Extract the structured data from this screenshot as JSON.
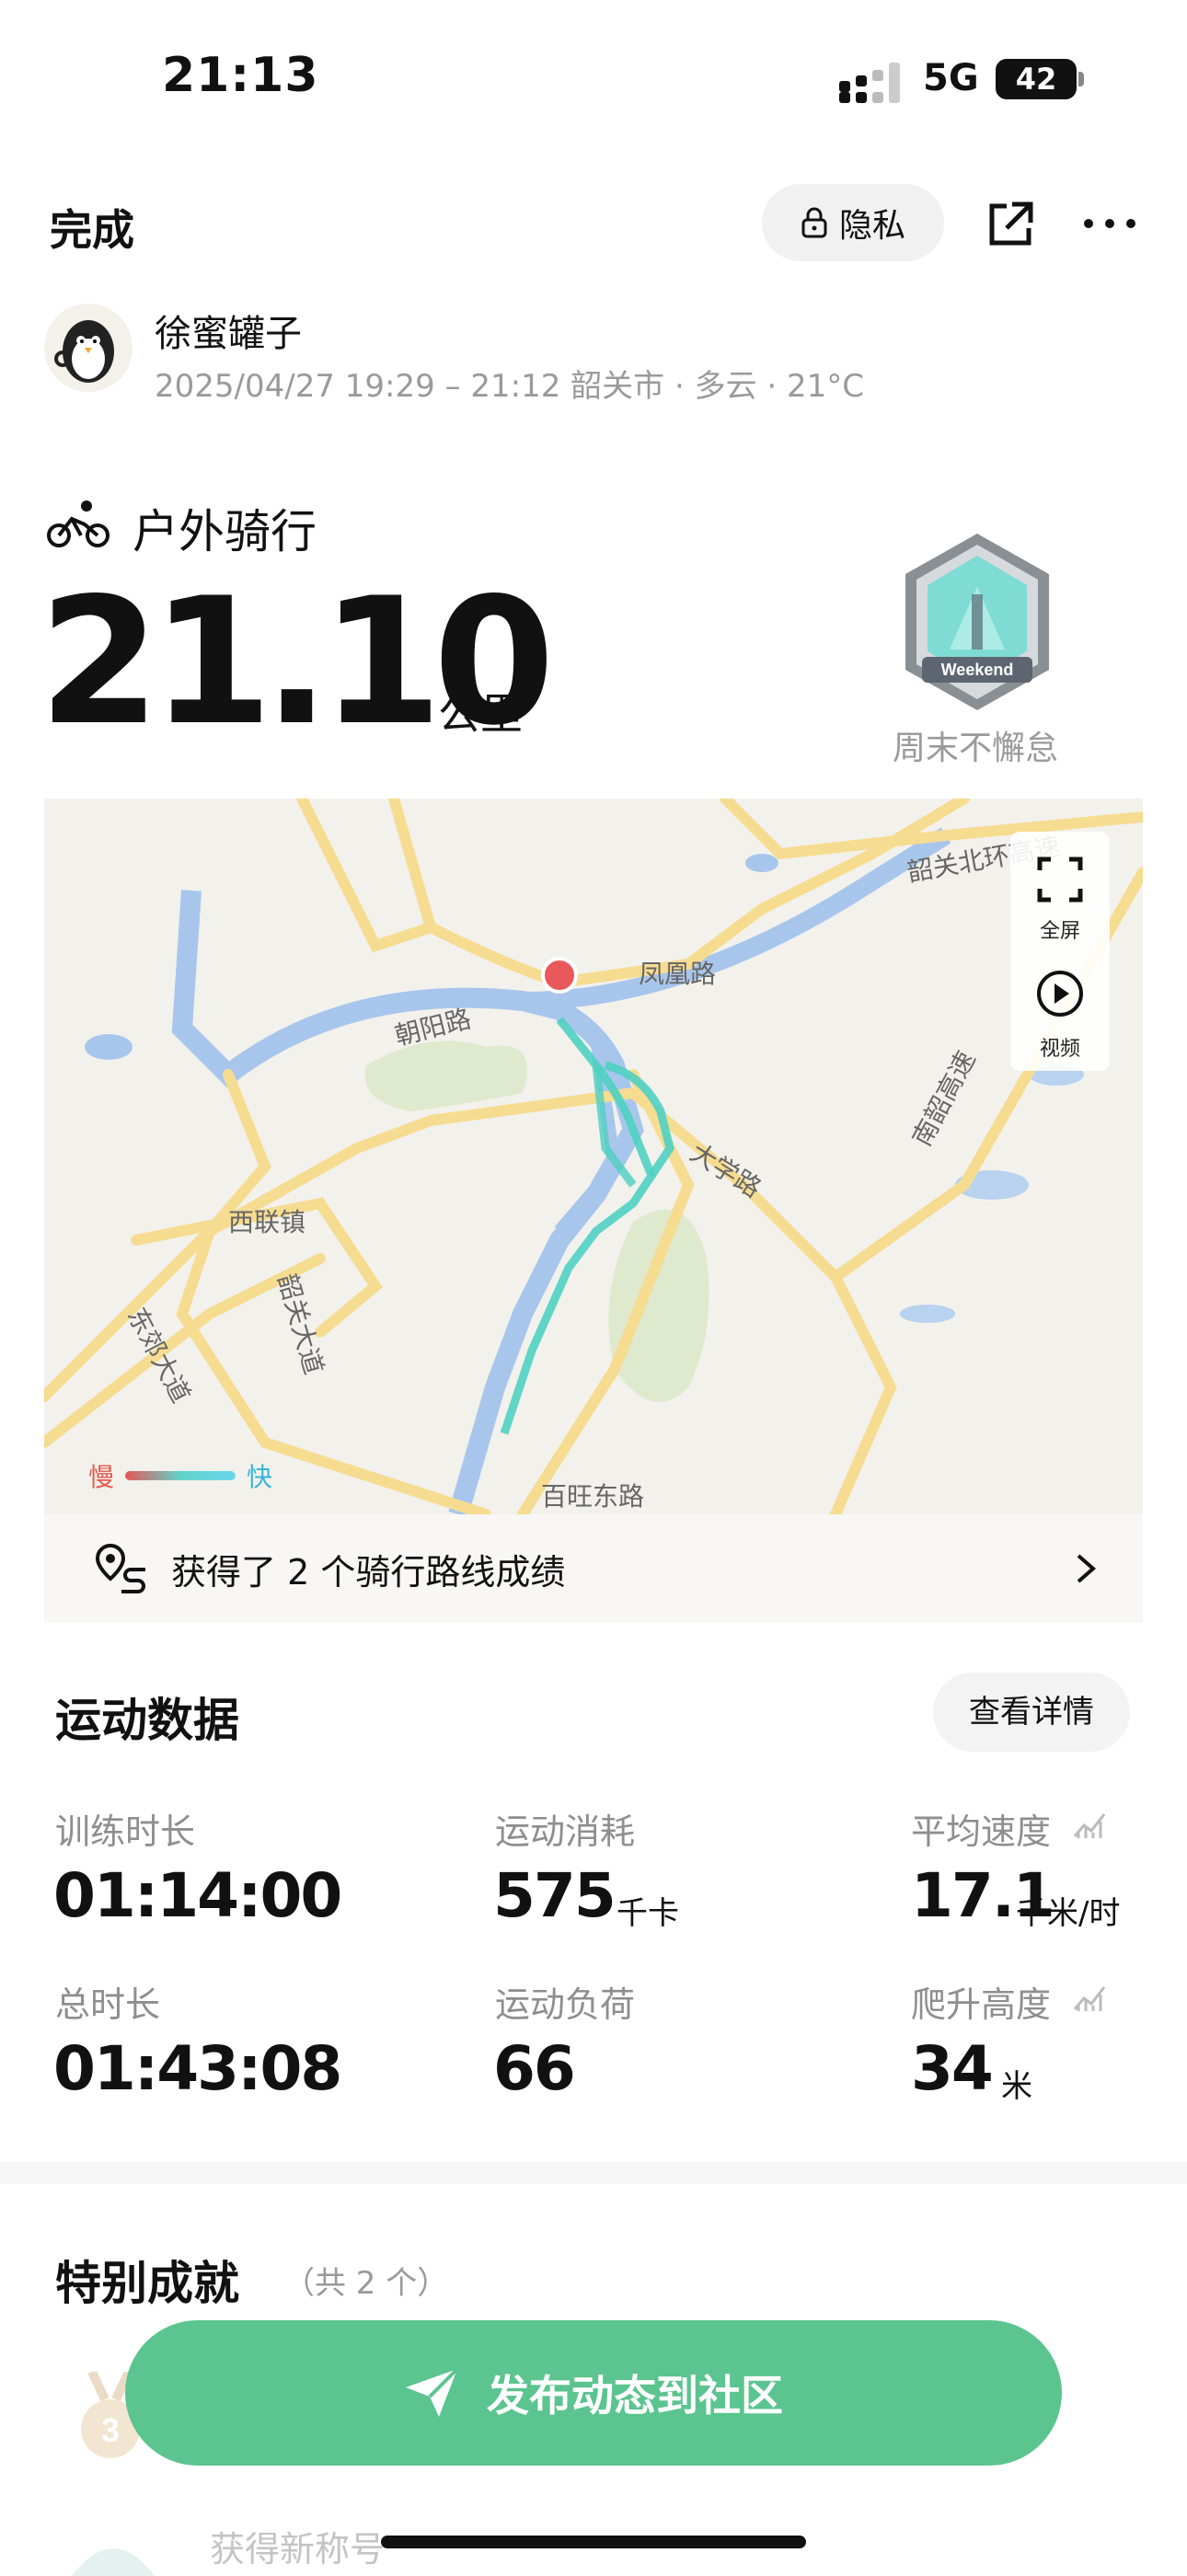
{
  "status_bar": {
    "time": "21:13",
    "network": "5G",
    "battery": "42"
  },
  "header": {
    "done_label": "完成",
    "privacy_label": "隐私"
  },
  "user": {
    "name": "徐蜜罐子",
    "meta": "2025/04/27 19:29 – 21:12 韶关市 · 多云 · 21°C"
  },
  "activity": {
    "type": "户外骑行",
    "distance": "21.10",
    "unit": "公里",
    "badge_text": "Weekend",
    "badge_label": "周末不懈怠"
  },
  "map": {
    "fullscreen_label": "全屏",
    "video_label": "视频",
    "labels": [
      "凤凰路",
      "朝阳路",
      "韶关北环高速",
      "大学路",
      "西联镇",
      "东郊大道",
      "韶关大道",
      "百旺东路",
      "南韶高速"
    ],
    "speed_slow": "慢",
    "speed_fast": "快",
    "colors": {
      "route": "#4fd0c3",
      "start_marker": "#e8595c",
      "river": "#a8c6ec",
      "road": "#f6dc91"
    }
  },
  "route_bar": {
    "text": "获得了 2 个骑行路线成绩"
  },
  "stats": {
    "title": "运动数据",
    "details_label": "查看详情",
    "items": [
      {
        "label": "训练时长",
        "value": "01:14:00",
        "unit": ""
      },
      {
        "label": "运动消耗",
        "value": "575",
        "unit": "千卡"
      },
      {
        "label": "平均速度",
        "value": "17.1",
        "unit": "千米/时"
      },
      {
        "label": "总时长",
        "value": "01:43:08",
        "unit": ""
      },
      {
        "label": "运动负荷",
        "value": "66",
        "unit": ""
      },
      {
        "label": "爬升高度",
        "value": "34",
        "unit": "米"
      }
    ]
  },
  "achievements": {
    "title": "特别成就",
    "count": "（共 2 个）",
    "medal_number": "3",
    "hidden_item": "获得新称号"
  },
  "publish": {
    "label": "发布动态到社区",
    "color": "#5bc48f"
  }
}
